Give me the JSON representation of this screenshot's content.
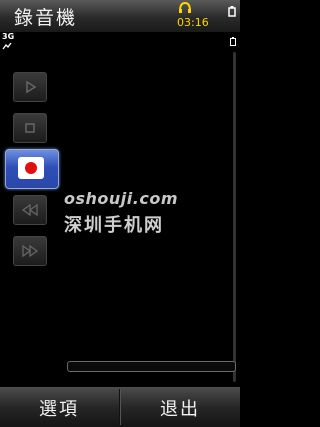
{
  "app": {
    "title": "錄音機"
  },
  "status": {
    "time": "03:16",
    "network": "3G"
  },
  "controls": [
    "play",
    "stop",
    "record",
    "rewind",
    "fast-forward"
  ],
  "watermark": {
    "line1": "oshouji.com",
    "line2": "深圳手机网"
  },
  "recording_progress": 0,
  "softkeys": {
    "left": "選項",
    "right": "退出"
  },
  "colors": {
    "time": "#ffd400",
    "record_button": "#2f4fb8",
    "record_dot": "#e01010"
  }
}
